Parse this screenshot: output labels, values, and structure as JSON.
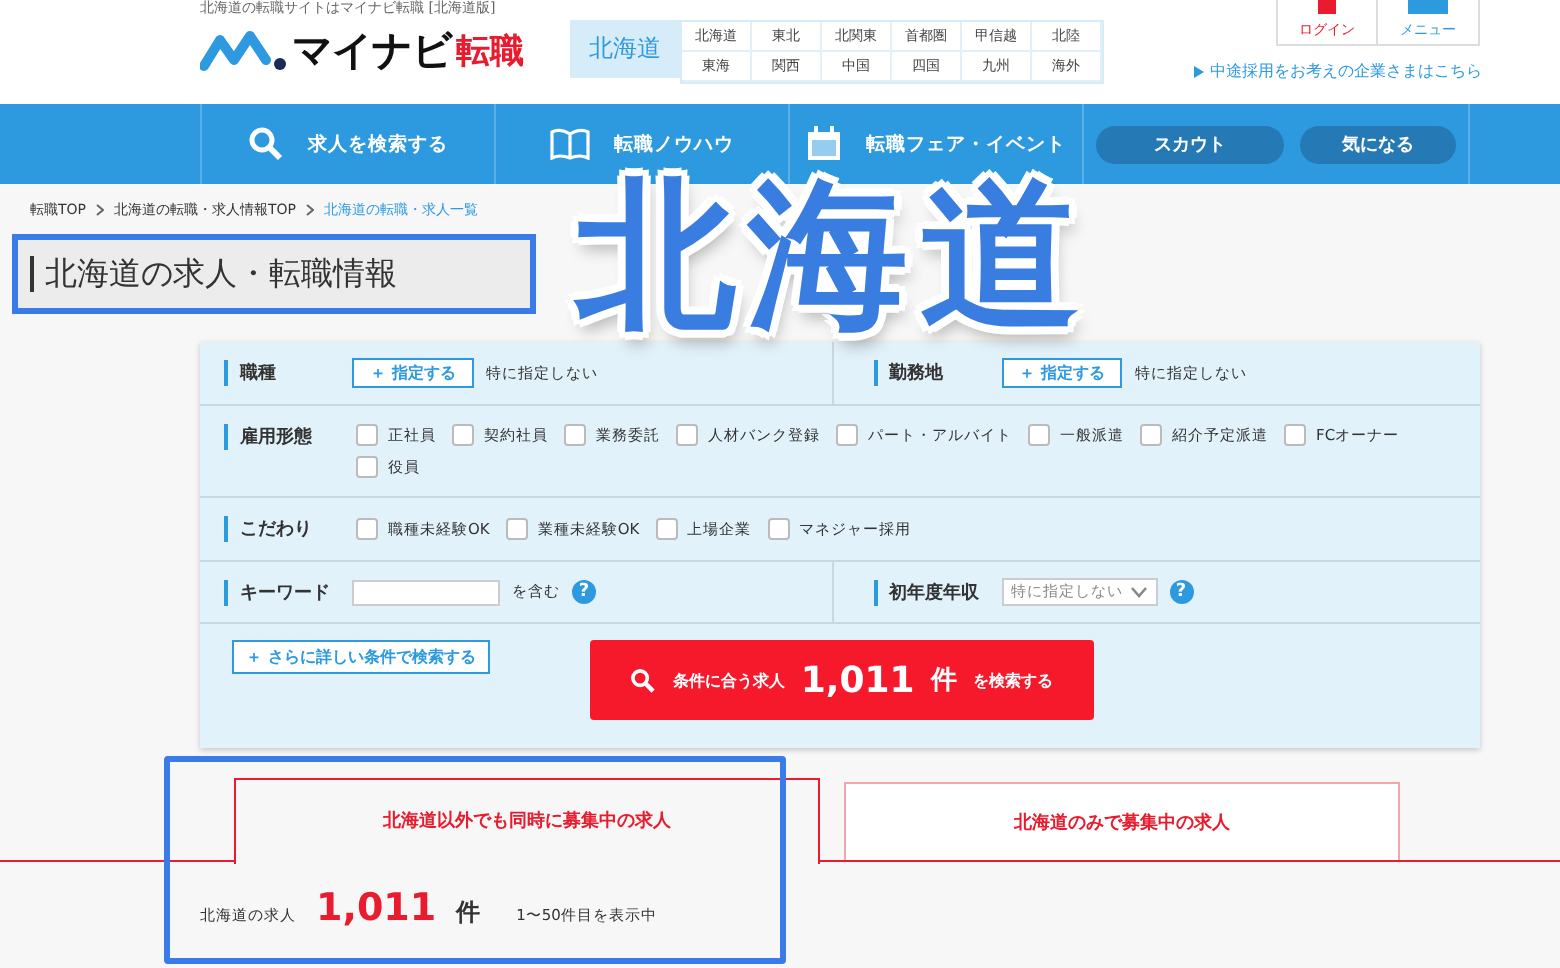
{
  "header": {
    "tagline": "北海道の転職サイトはマイナビ転職 [北海道版]",
    "logo_text": "マイナビ",
    "logo_accent": "転職",
    "region_current": "北海道",
    "regions": [
      [
        "北海道",
        "東北",
        "北関東",
        "首都圏",
        "甲信越",
        "北陸"
      ],
      [
        "東海",
        "関西",
        "中国",
        "四国",
        "九州",
        "海外"
      ]
    ],
    "login": "ログイン",
    "menu": "メニュー",
    "employer_link": "中途採用をお考えの企業さまはこちら"
  },
  "nav": {
    "items": [
      {
        "label": "求人を検索する",
        "kind": "search"
      },
      {
        "label": "転職ノウハウ",
        "kind": "book"
      },
      {
        "label": "転職フェア・イベント",
        "kind": "calendar"
      }
    ],
    "pills": [
      "スカウト",
      "気になる"
    ]
  },
  "breadcrumb": [
    {
      "label": "転職TOP",
      "current": false
    },
    {
      "label": "北海道の転職・求人情報TOP",
      "current": false
    },
    {
      "label": "北海道の転職・求人一覧",
      "current": true
    }
  ],
  "page_title": "北海道の求人・転職情報",
  "overlay_caption": "北海道",
  "search": {
    "job_type": {
      "label": "職種",
      "button": "＋ 指定する",
      "value": "特に指定しない"
    },
    "location": {
      "label": "勤務地",
      "button": "＋ 指定する",
      "value": "特に指定しない"
    },
    "employment": {
      "label": "雇用形態",
      "options": [
        {
          "label": "正社員",
          "checked": false
        },
        {
          "label": "契約社員",
          "checked": false
        },
        {
          "label": "業務委託",
          "checked": false
        },
        {
          "label": "人材バンク登録",
          "checked": false
        },
        {
          "label": "パート・アルバイト",
          "checked": false
        },
        {
          "label": "一般派遣",
          "checked": false
        },
        {
          "label": "紹介予定派遣",
          "checked": false
        },
        {
          "label": "FCオーナー",
          "checked": false
        },
        {
          "label": "役員",
          "checked": false
        }
      ]
    },
    "preferences": {
      "label": "こだわり",
      "options": [
        {
          "label": "職種未経験OK",
          "checked": false
        },
        {
          "label": "業種未経験OK",
          "checked": false
        },
        {
          "label": "上場企業",
          "checked": false
        },
        {
          "label": "マネジャー採用",
          "checked": false
        }
      ]
    },
    "keyword": {
      "label": "キーワード",
      "suffix": "を含む",
      "help": "?"
    },
    "salary": {
      "label": "初年度年収",
      "value": "特に指定しない",
      "help": "?"
    },
    "detail_button": "＋ さらに詳しい条件で検索する",
    "submit": {
      "prefix": "条件に合う求人",
      "count": "1,011",
      "unit": "件",
      "suffix": "を検索する"
    }
  },
  "tabs": [
    {
      "label": "北海道以外でも同時に募集中の求人",
      "selected": true
    },
    {
      "label": "北海道のみで募集中の求人",
      "selected": false
    }
  ],
  "results": {
    "label": "北海道の求人",
    "count": "1,011",
    "unit": "件",
    "range": "1〜50件目を表示中"
  }
}
